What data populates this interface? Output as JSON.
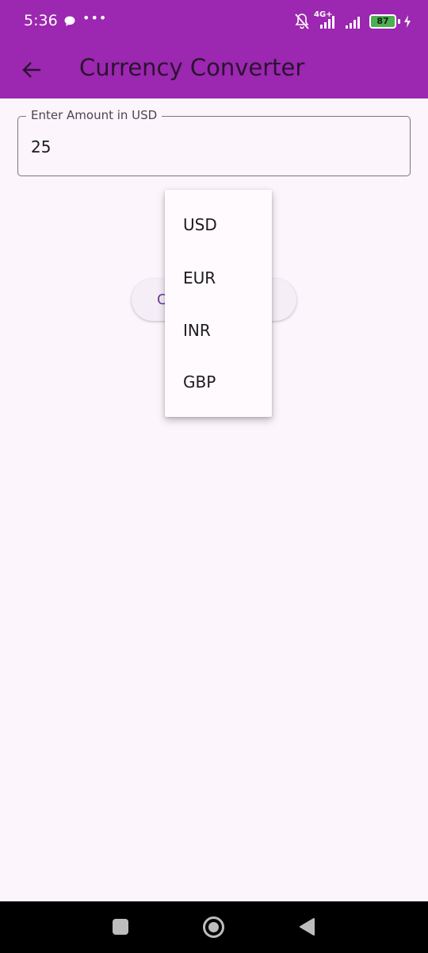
{
  "status_bar": {
    "time": "5:36",
    "dots": "•••",
    "network": "4G+",
    "battery": "87"
  },
  "app_bar": {
    "title": "Currency Converter",
    "back_icon": "arrow-left-icon",
    "background": "#9c27b0"
  },
  "amount_field": {
    "label": "Enter Amount in USD",
    "value": "25"
  },
  "convert_button": {
    "visible_text": "C"
  },
  "dropdown": {
    "options": [
      "USD",
      "EUR",
      "INR",
      "GBP"
    ]
  },
  "nav_bar": {
    "icons": [
      "recent-apps-icon",
      "home-icon",
      "back-triangle-icon"
    ]
  }
}
